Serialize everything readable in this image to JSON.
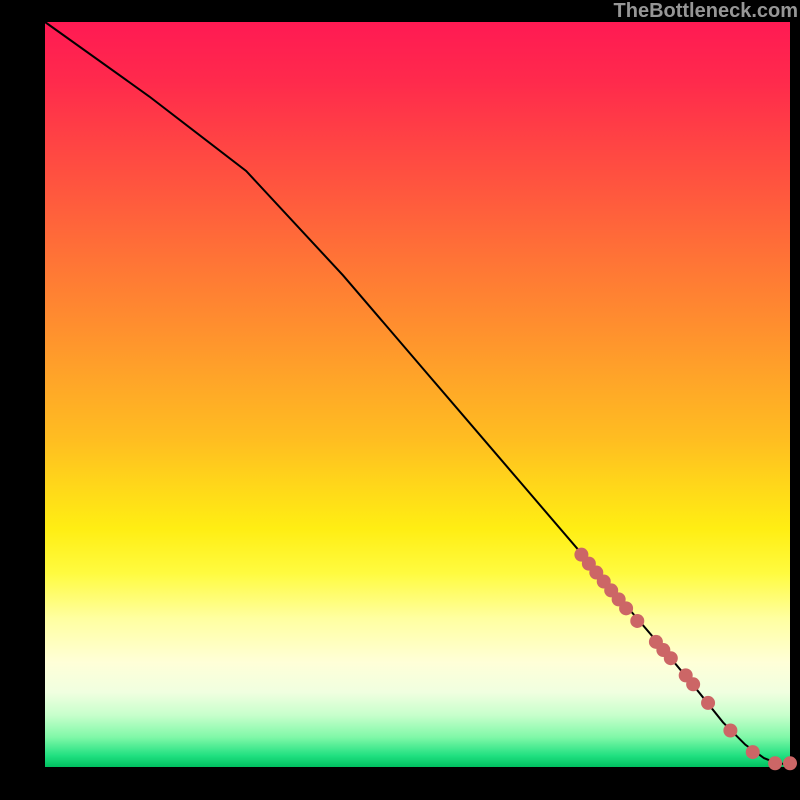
{
  "watermark": "TheBottleneck.com",
  "chart_data": {
    "type": "line",
    "title": "",
    "xlabel": "",
    "ylabel": "",
    "xlim": [
      0,
      100
    ],
    "ylim": [
      0,
      100
    ],
    "curve": {
      "x": [
        0,
        14,
        27,
        40,
        52,
        64,
        76,
        82,
        87,
        91,
        94,
        96.5,
        98.5,
        100
      ],
      "y": [
        100,
        90,
        80,
        66,
        52,
        38,
        24,
        17,
        11,
        6,
        3,
        1.2,
        0.4,
        0.5
      ]
    },
    "dots": {
      "x": [
        72,
        73,
        74,
        75,
        76,
        77,
        78,
        79.5,
        82,
        83,
        84,
        86,
        87,
        89,
        92,
        95,
        98,
        100
      ],
      "y": [
        28.5,
        27.3,
        26.1,
        24.9,
        23.7,
        22.5,
        21.3,
        19.6,
        16.8,
        15.7,
        14.6,
        12.3,
        11.1,
        8.6,
        4.9,
        2.0,
        0.5,
        0.5
      ]
    }
  }
}
